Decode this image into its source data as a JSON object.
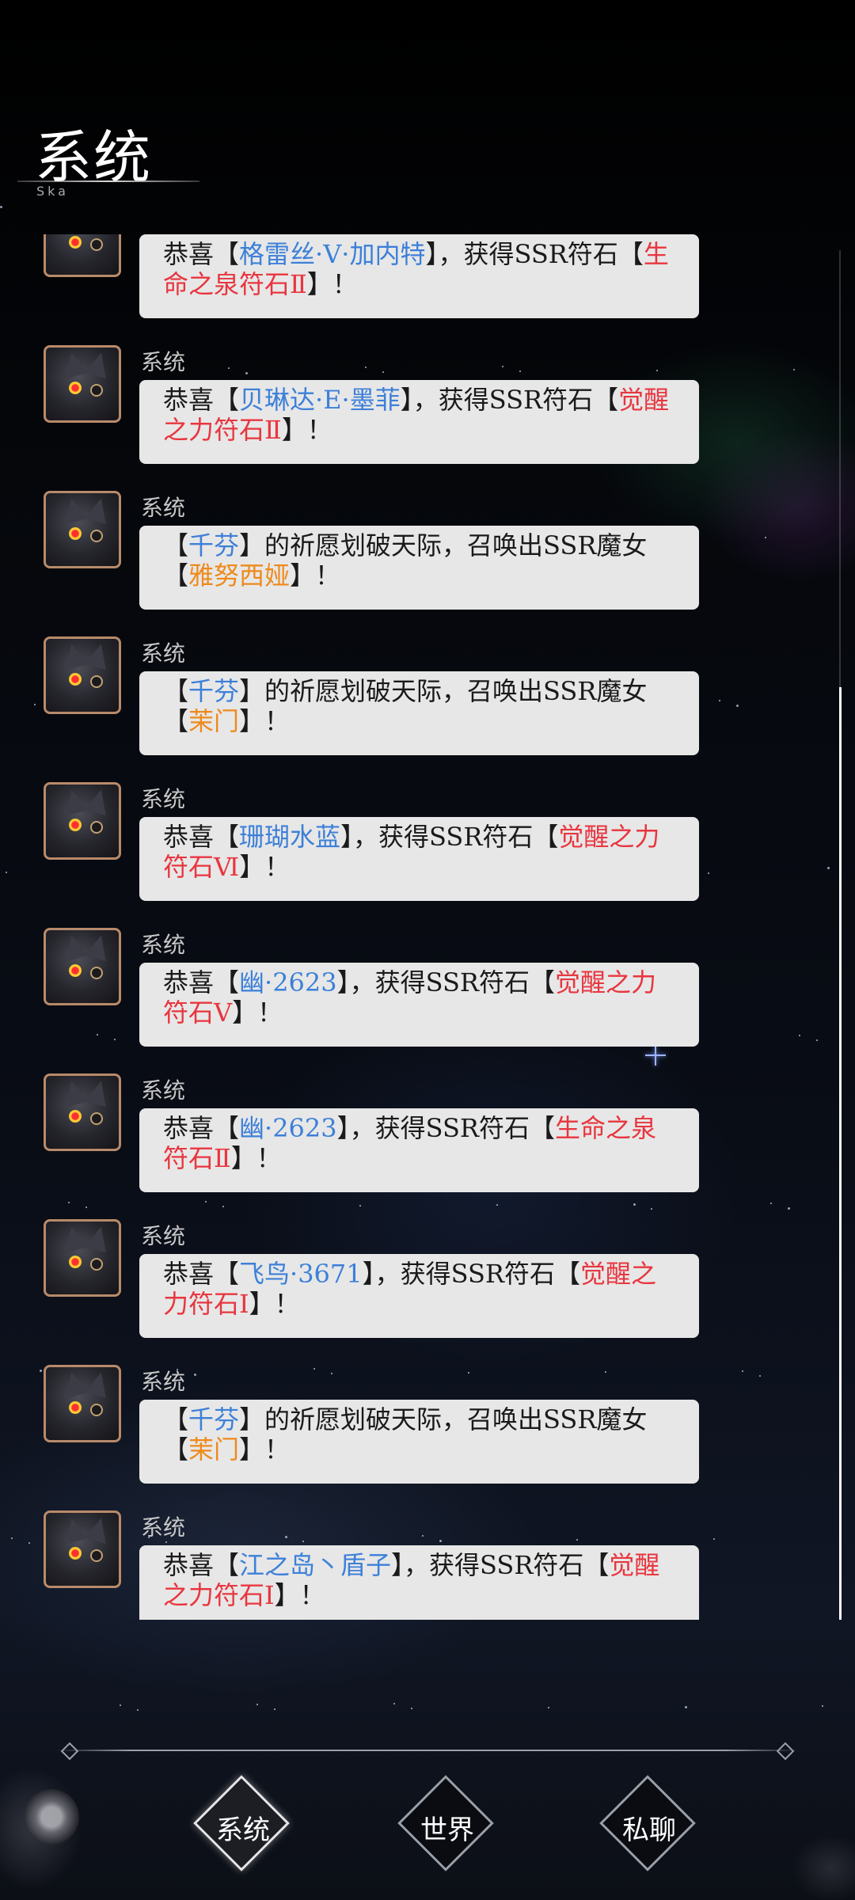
{
  "header": {
    "title": "系统",
    "subtitle": "Ska"
  },
  "messages": [
    {
      "sender": "系统",
      "parts": [
        {
          "t": "恭喜【",
          "c": ""
        },
        {
          "t": "格雷丝·V·加内特",
          "c": "blue"
        },
        {
          "t": "】，获得SSR符石【",
          "c": ""
        },
        {
          "t": "生命之泉符石Ⅱ",
          "c": "red"
        },
        {
          "t": "】！",
          "c": ""
        }
      ]
    },
    {
      "sender": "系统",
      "parts": [
        {
          "t": "恭喜【",
          "c": ""
        },
        {
          "t": "贝琳达·E·墨菲",
          "c": "blue"
        },
        {
          "t": "】，获得SSR符石【",
          "c": ""
        },
        {
          "t": "觉醒之力符石Ⅱ",
          "c": "red"
        },
        {
          "t": "】！",
          "c": ""
        }
      ]
    },
    {
      "sender": "系统",
      "parts": [
        {
          "t": "【",
          "c": ""
        },
        {
          "t": "千芬",
          "c": "blue"
        },
        {
          "t": "】的祈愿划破天际，召唤出SSR魔女【",
          "c": ""
        },
        {
          "t": "雅努西娅",
          "c": "orange"
        },
        {
          "t": "】！",
          "c": ""
        }
      ]
    },
    {
      "sender": "系统",
      "parts": [
        {
          "t": "【",
          "c": ""
        },
        {
          "t": "千芬",
          "c": "blue"
        },
        {
          "t": "】的祈愿划破天际，召唤出SSR魔女【",
          "c": ""
        },
        {
          "t": "茉门",
          "c": "orange"
        },
        {
          "t": "】！",
          "c": ""
        }
      ]
    },
    {
      "sender": "系统",
      "parts": [
        {
          "t": "恭喜【",
          "c": ""
        },
        {
          "t": "珊瑚水蓝",
          "c": "blue"
        },
        {
          "t": "】，获得SSR符石【",
          "c": ""
        },
        {
          "t": "觉醒之力符石Ⅵ",
          "c": "red"
        },
        {
          "t": "】！",
          "c": ""
        }
      ]
    },
    {
      "sender": "系统",
      "parts": [
        {
          "t": "恭喜【",
          "c": ""
        },
        {
          "t": "幽·2623",
          "c": "blue"
        },
        {
          "t": "】，获得SSR符石【",
          "c": ""
        },
        {
          "t": "觉醒之力符石Ⅴ",
          "c": "red"
        },
        {
          "t": "】！",
          "c": ""
        }
      ]
    },
    {
      "sender": "系统",
      "parts": [
        {
          "t": "恭喜【",
          "c": ""
        },
        {
          "t": "幽·2623",
          "c": "blue"
        },
        {
          "t": "】，获得SSR符石【",
          "c": ""
        },
        {
          "t": "生命之泉符石Ⅱ",
          "c": "red"
        },
        {
          "t": "】！",
          "c": ""
        }
      ]
    },
    {
      "sender": "系统",
      "parts": [
        {
          "t": "恭喜【",
          "c": ""
        },
        {
          "t": "飞鸟·3671",
          "c": "blue"
        },
        {
          "t": "】，获得SSR符石【",
          "c": ""
        },
        {
          "t": "觉醒之力符石Ⅰ",
          "c": "red"
        },
        {
          "t": "】！",
          "c": ""
        }
      ]
    },
    {
      "sender": "系统",
      "parts": [
        {
          "t": "【",
          "c": ""
        },
        {
          "t": "千芬",
          "c": "blue"
        },
        {
          "t": "】的祈愿划破天际，召唤出SSR魔女【",
          "c": ""
        },
        {
          "t": "茉门",
          "c": "orange"
        },
        {
          "t": "】！",
          "c": ""
        }
      ]
    },
    {
      "sender": "系统",
      "parts": [
        {
          "t": "恭喜【",
          "c": ""
        },
        {
          "t": "江之岛丶盾子",
          "c": "blue"
        },
        {
          "t": "】，获得SSR符石【",
          "c": ""
        },
        {
          "t": "觉醒之力符石Ⅰ",
          "c": "red"
        },
        {
          "t": "】！",
          "c": ""
        }
      ]
    }
  ],
  "tabs": [
    {
      "label": "系统",
      "active": true
    },
    {
      "label": "世界",
      "active": false
    },
    {
      "label": "私聊",
      "active": false
    }
  ],
  "colors": {
    "player": "#3d80d8",
    "rune": "#e8363f",
    "witch": "#ee8a1c",
    "bubble": "#e7e7e7",
    "avatar_border": "#b88a6a"
  }
}
